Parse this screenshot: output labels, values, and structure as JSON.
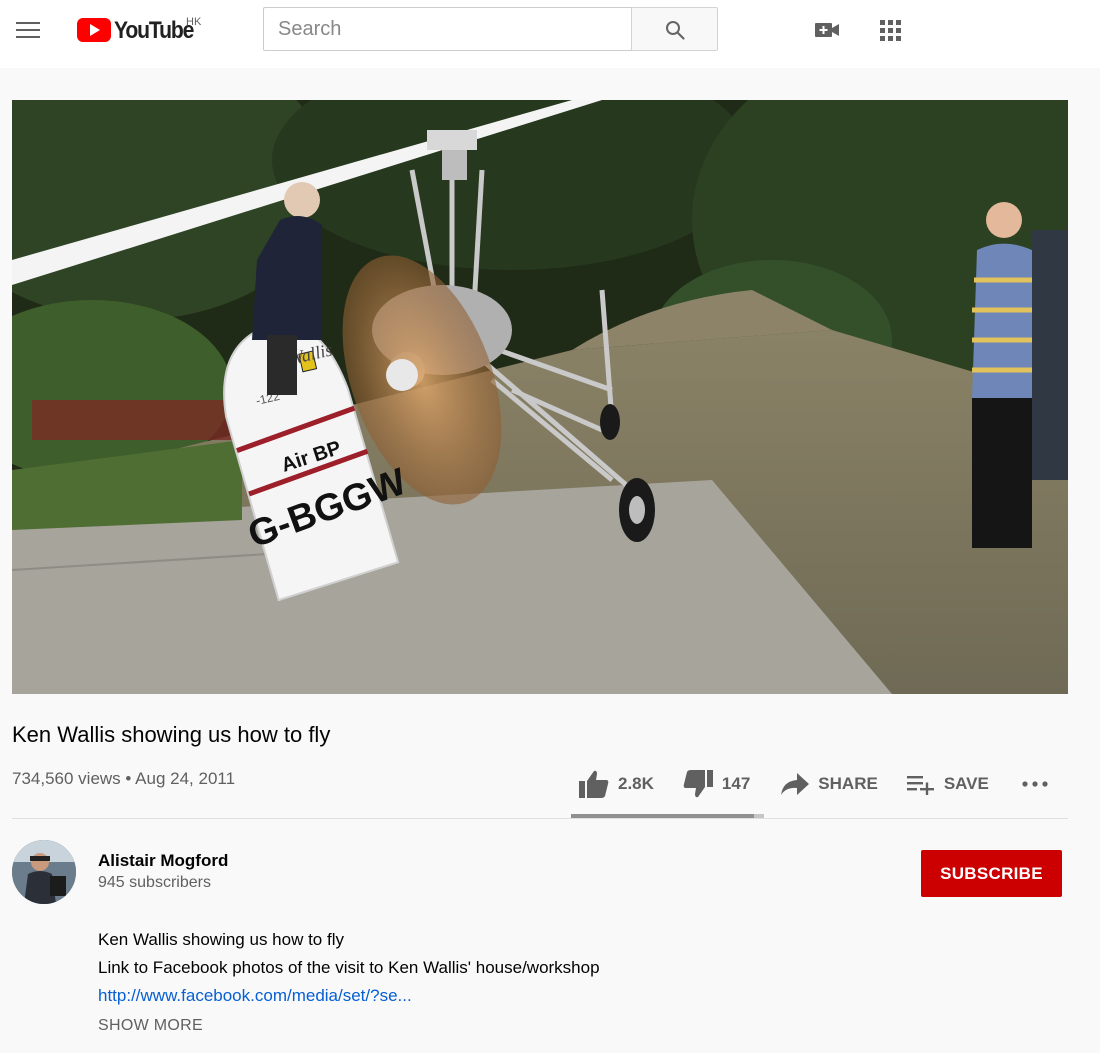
{
  "header": {
    "logo_text": "YouTube",
    "region": "HK",
    "search_placeholder": "Search"
  },
  "video": {
    "title": "Ken Wallis showing us how to fly",
    "views": "734,560 views",
    "separator": "•",
    "date": "Aug 24, 2011",
    "frame_text": {
      "plate_brand": "Wallis",
      "plate_number": "-122",
      "plate_sponsor": "Air BP",
      "registration": "G-BGGW"
    }
  },
  "actions": {
    "likes": "2.8K",
    "dislikes": "147",
    "share": "SHARE",
    "save": "SAVE",
    "like_ratio": 0.95
  },
  "channel": {
    "name": "Alistair Mogford",
    "subscribers": "945 subscribers",
    "subscribe_label": "SUBSCRIBE"
  },
  "description": {
    "line1": "Ken Wallis showing us how to fly",
    "line2": "Link to Facebook photos of the visit to Ken Wallis' house/workshop",
    "link": "http://www.facebook.com/media/set/?se...",
    "show_more": "SHOW MORE"
  },
  "colors": {
    "brand_red": "#ff0000",
    "subscribe_red": "#cc0000",
    "link_blue": "#065fd4"
  },
  "icons": [
    "menu-icon",
    "youtube-logo-icon",
    "search-icon",
    "create-video-icon",
    "apps-grid-icon",
    "like-icon",
    "dislike-icon",
    "share-icon",
    "save-playlist-icon",
    "more-icon"
  ]
}
